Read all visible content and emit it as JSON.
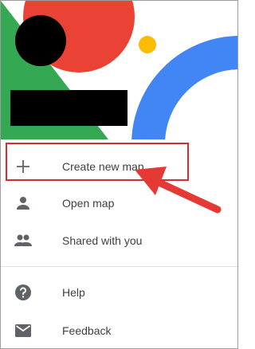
{
  "menu": {
    "items": [
      {
        "label": "Create new map",
        "icon": "plus-icon"
      },
      {
        "label": "Open map",
        "icon": "person-icon"
      },
      {
        "label": "Shared with you",
        "icon": "people-icon"
      },
      {
        "label": "Help",
        "icon": "help-circle-icon"
      },
      {
        "label": "Feedback",
        "icon": "mail-icon"
      }
    ]
  },
  "colors": {
    "red": "#ea4335",
    "green": "#34a853",
    "blue": "#4285f4",
    "yellow": "#fbbc04",
    "highlight": "#d32f2f",
    "icon": "#5f6368"
  }
}
